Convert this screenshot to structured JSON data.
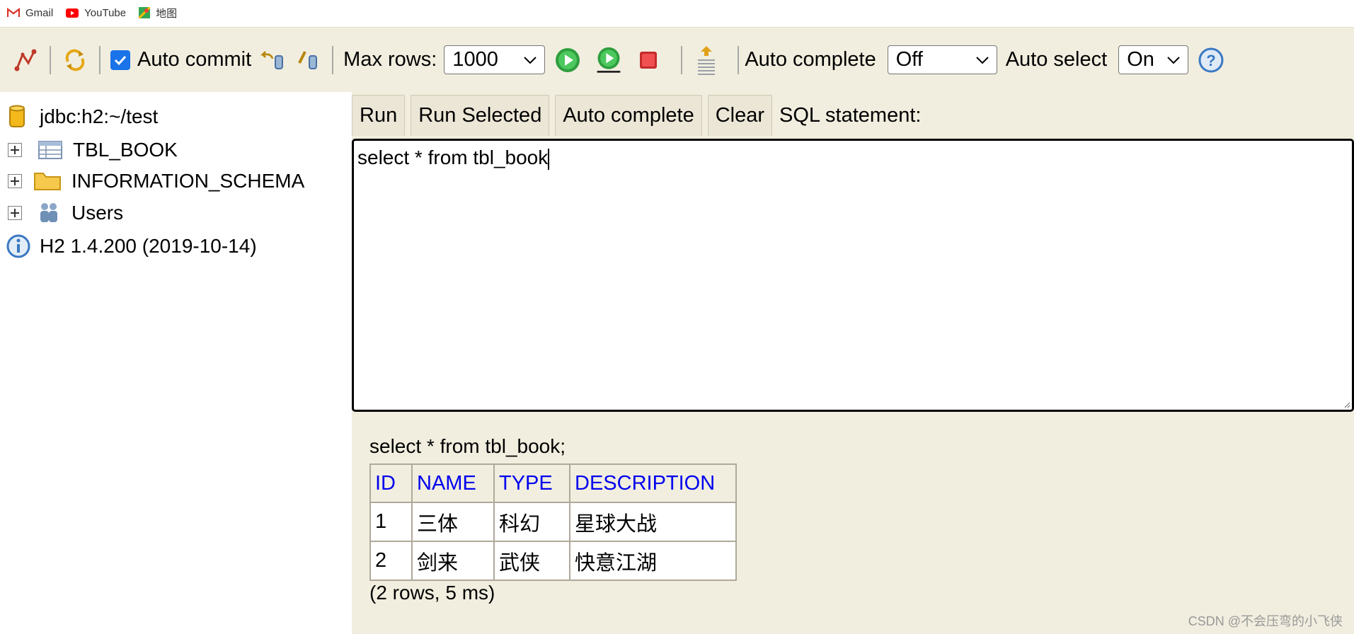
{
  "bookmarks": [
    {
      "label": "Gmail",
      "icon": "gmail-icon"
    },
    {
      "label": "YouTube",
      "icon": "youtube-icon"
    },
    {
      "label": "地图",
      "icon": "maps-icon"
    }
  ],
  "toolbar": {
    "auto_commit_label": "Auto commit",
    "auto_commit_checked": true,
    "max_rows_label": "Max rows:",
    "max_rows_value": "1000",
    "auto_complete_label": "Auto complete",
    "auto_complete_value": "Off",
    "auto_select_label": "Auto select",
    "auto_select_value": "On"
  },
  "tree": {
    "connection": "jdbc:h2:~/test",
    "items": [
      {
        "label": "TBL_BOOK",
        "icon": "table-icon"
      },
      {
        "label": "INFORMATION_SCHEMA",
        "icon": "folder-icon"
      },
      {
        "label": "Users",
        "icon": "users-icon"
      }
    ],
    "version": "H2 1.4.200 (2019-10-14)"
  },
  "buttons": {
    "run": "Run",
    "run_selected": "Run Selected",
    "auto_complete": "Auto complete",
    "clear": "Clear",
    "sql_label": "SQL statement:"
  },
  "editor": {
    "text": "select * from tbl_book"
  },
  "result": {
    "query": "select * from tbl_book;",
    "columns": [
      "ID",
      "NAME",
      "TYPE",
      "DESCRIPTION"
    ],
    "rows": [
      [
        "1",
        "三体",
        "科幻",
        "星球大战"
      ],
      [
        "2",
        "剑来",
        "武侠",
        "快意江湖"
      ]
    ],
    "summary": "(2 rows, 5 ms)"
  },
  "watermark": "CSDN @不会压弯的小飞侠",
  "colors": {
    "panel_bg": "#f1eedf",
    "header_link": "#0000ee",
    "checkbox": "#1a73e8"
  }
}
